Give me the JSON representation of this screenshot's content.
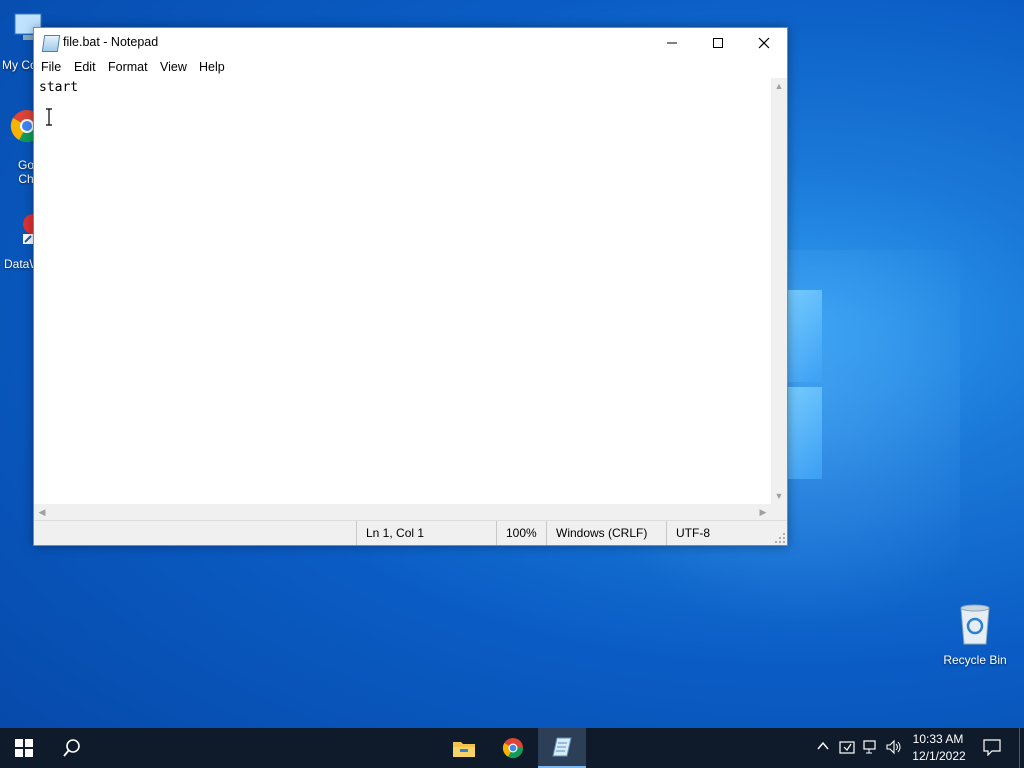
{
  "window": {
    "title": "file.bat - Notepad",
    "controls": {
      "minimize": "—",
      "maximize": "☐",
      "close": "✕"
    }
  },
  "menu": [
    "File",
    "Edit",
    "Format",
    "View",
    "Help"
  ],
  "editor": {
    "content": "start"
  },
  "status": {
    "position": "Ln 1, Col 1",
    "zoom": "100%",
    "line_ending": "Windows (CRLF)",
    "encoding": "UTF-8"
  },
  "desktop": {
    "icons": [
      {
        "label": "My Co",
        "icon": "computer-icon"
      },
      {
        "label": "Go\nCh",
        "icon": "chrome-icon"
      },
      {
        "label": "DataW",
        "icon": "app-icon"
      },
      {
        "label": "Recycle Bin",
        "icon": "recycle-bin-icon"
      }
    ]
  },
  "taskbar": {
    "pinned": [
      "file-explorer-icon",
      "chrome-icon",
      "notepad-icon"
    ],
    "clock": {
      "time": "10:33 AM",
      "date": "12/1/2022"
    }
  },
  "colors": {
    "accent": "#0a5cc4",
    "taskbar": "#0f1b2b",
    "active_indicator": "#7fb8ef"
  }
}
